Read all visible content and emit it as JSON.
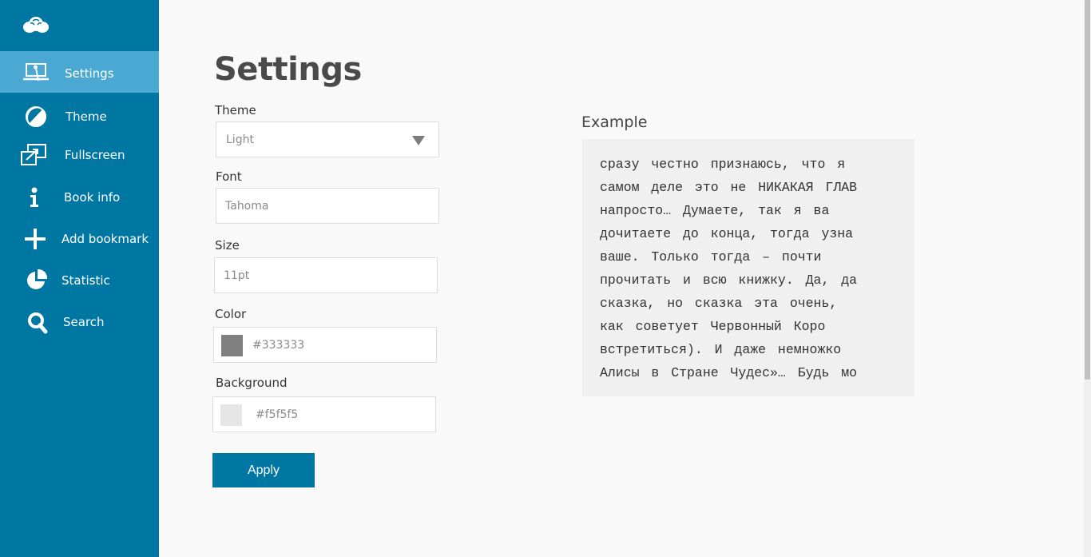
{
  "sidebar": {
    "logo": "cloud-logo",
    "items": [
      {
        "label": "Settings",
        "icon": "laptop-settings-icon",
        "active": true
      },
      {
        "label": "Theme",
        "icon": "half-circle-icon"
      },
      {
        "label": "Fullscreen",
        "icon": "fullscreen-icon"
      },
      {
        "label": "Book info",
        "icon": "info-icon"
      },
      {
        "label": "Add bookmark",
        "icon": "plus-icon"
      },
      {
        "label": "Statistic",
        "icon": "pie-chart-icon"
      },
      {
        "label": "Search",
        "icon": "search-icon"
      }
    ]
  },
  "page": {
    "title": "Settings"
  },
  "form": {
    "theme": {
      "label": "Theme",
      "value": "Light"
    },
    "font": {
      "label": "Font",
      "value": "Tahoma"
    },
    "size": {
      "label": "Size",
      "value": "11pt"
    },
    "color": {
      "label": "Color",
      "value": "#333333",
      "swatch": "#808080"
    },
    "background": {
      "label": "Background",
      "value": "#f5f5f5",
      "swatch": "#e6e6e6"
    },
    "apply_label": "Apply"
  },
  "example": {
    "title": "Example",
    "lines": [
      "сразу честно признаюсь, что я",
      "самом деле это не НИКАКАЯ ГЛАВ",
      "напросто… Думаете, так я ва",
      "дочитаете до конца, тогда узна",
      "ваше. Только тогда – почти",
      "прочитать и всю книжку. Да, да",
      "сказка, но сказка эта очень,",
      "как советует Червонный Коро",
      "встретиться). И даже немножко",
      "Алисы в Стране Чудес»… Будь мо"
    ]
  },
  "colors": {
    "sidebar": "#0077a3",
    "active_item": "#4ba8d2",
    "button": "#0077a3"
  }
}
